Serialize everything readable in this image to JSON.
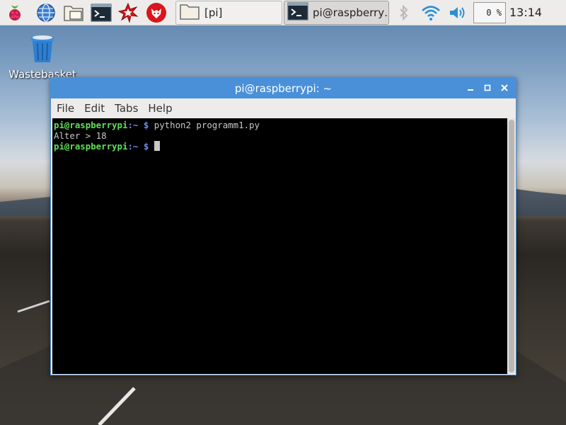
{
  "taskbar": {
    "launchers": [
      {
        "icon": "raspberry-menu-icon"
      },
      {
        "icon": "web-browser-icon"
      },
      {
        "icon": "file-manager-icon"
      },
      {
        "icon": "terminal-icon"
      },
      {
        "icon": "mathematica-icon"
      },
      {
        "icon": "wolfram-icon"
      }
    ],
    "tasks": [
      {
        "label": "[pi]",
        "icon": "folder-icon",
        "active": false
      },
      {
        "label": "pi@raspberry…",
        "icon": "terminal-icon",
        "active": true
      }
    ],
    "tray": {
      "bluetooth_icon": "bluetooth-icon",
      "wifi_icon": "wifi-icon",
      "volume_icon": "volume-icon",
      "cpu": "0 %",
      "clock": "13:14"
    }
  },
  "desktop": {
    "icons": [
      {
        "label": "Wastebasket",
        "icon": "trash-icon"
      }
    ]
  },
  "terminal": {
    "title": "pi@raspberrypi: ~",
    "menu": [
      "File",
      "Edit",
      "Tabs",
      "Help"
    ],
    "lines": [
      {
        "user": "pi@raspberrypi",
        "path": ":~",
        "prompt": " $ ",
        "command": "python2 programm1.py"
      },
      {
        "output": "Alter > 18"
      },
      {
        "user": "pi@raspberrypi",
        "path": ":~",
        "prompt": " $ ",
        "command": ""
      }
    ]
  },
  "colors": {
    "titlebar": "#4a90d9",
    "prompt_user": "#5fe058",
    "prompt_path": "#6e8cf0",
    "terminal_bg": "#000000"
  }
}
